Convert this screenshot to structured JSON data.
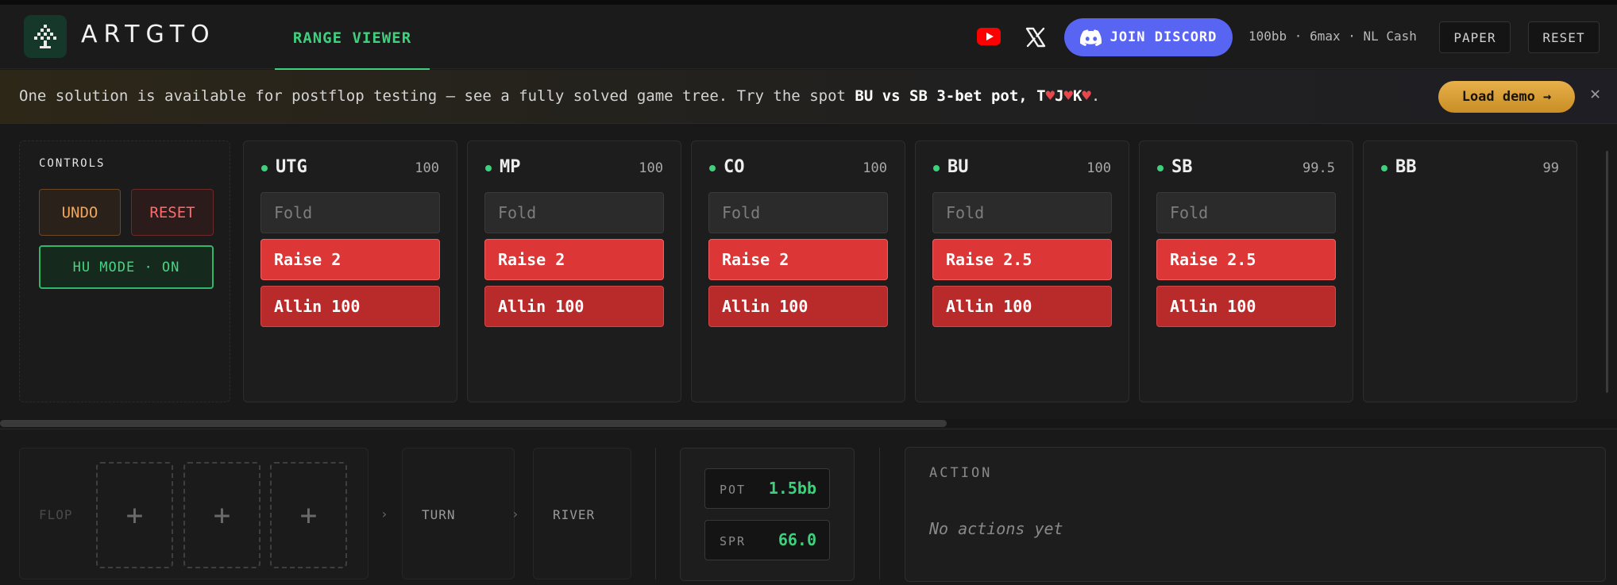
{
  "header": {
    "brand": "ARTGTO",
    "active_tab": "RANGE VIEWER",
    "discord_label": "JOIN DISCORD",
    "game_info": "100bb · 6max · NL Cash",
    "paper_label": "PAPER",
    "reset_label": "RESET"
  },
  "banner": {
    "text_before": "One solution is available for postflop testing — see a fully solved game tree. Try the spot ",
    "spot": "BU vs SB 3-bet pot, T",
    "card2": "J",
    "card3": "K",
    "text_after": ".",
    "load_demo_label": "Load demo →",
    "close_label": "✕"
  },
  "controls": {
    "title": "CONTROLS",
    "undo_label": "UNDO",
    "reset_label": "RESET",
    "hu_mode_label": "HU MODE · ON"
  },
  "positions": [
    {
      "name": "UTG",
      "stack": "100",
      "fold": "Fold",
      "raise": "Raise 2",
      "allin": "Allin 100"
    },
    {
      "name": "MP",
      "stack": "100",
      "fold": "Fold",
      "raise": "Raise 2",
      "allin": "Allin 100"
    },
    {
      "name": "CO",
      "stack": "100",
      "fold": "Fold",
      "raise": "Raise 2",
      "allin": "Allin 100"
    },
    {
      "name": "BU",
      "stack": "100",
      "fold": "Fold",
      "raise": "Raise 2.5",
      "allin": "Allin 100"
    },
    {
      "name": "SB",
      "stack": "99.5",
      "fold": "Fold",
      "raise": "Raise 2.5",
      "allin": "Allin 100"
    },
    {
      "name": "BB",
      "stack": "99"
    }
  ],
  "board": {
    "flop_label": "FLOP",
    "add_symbol": "+",
    "chevron": "›",
    "turn_label": "TURN",
    "river_label": "RIVER"
  },
  "stats": {
    "pot_label": "POT",
    "pot_value": "1.5bb",
    "spr_label": "SPR",
    "spr_value": "66.0"
  },
  "action_panel": {
    "title": "ACTION",
    "empty_text": "No actions yet"
  },
  "colors": {
    "accent_green": "#3fd07d",
    "raise_red": "#dc3636",
    "allin_red": "#b92a2a",
    "discord_blue": "#5865f2",
    "demo_gold": "#e8b04a"
  },
  "icons": {
    "logo": "spade-tree-icon",
    "youtube": "youtube-icon",
    "x": "x-twitter-icon",
    "discord": "discord-icon",
    "close": "close-icon"
  }
}
